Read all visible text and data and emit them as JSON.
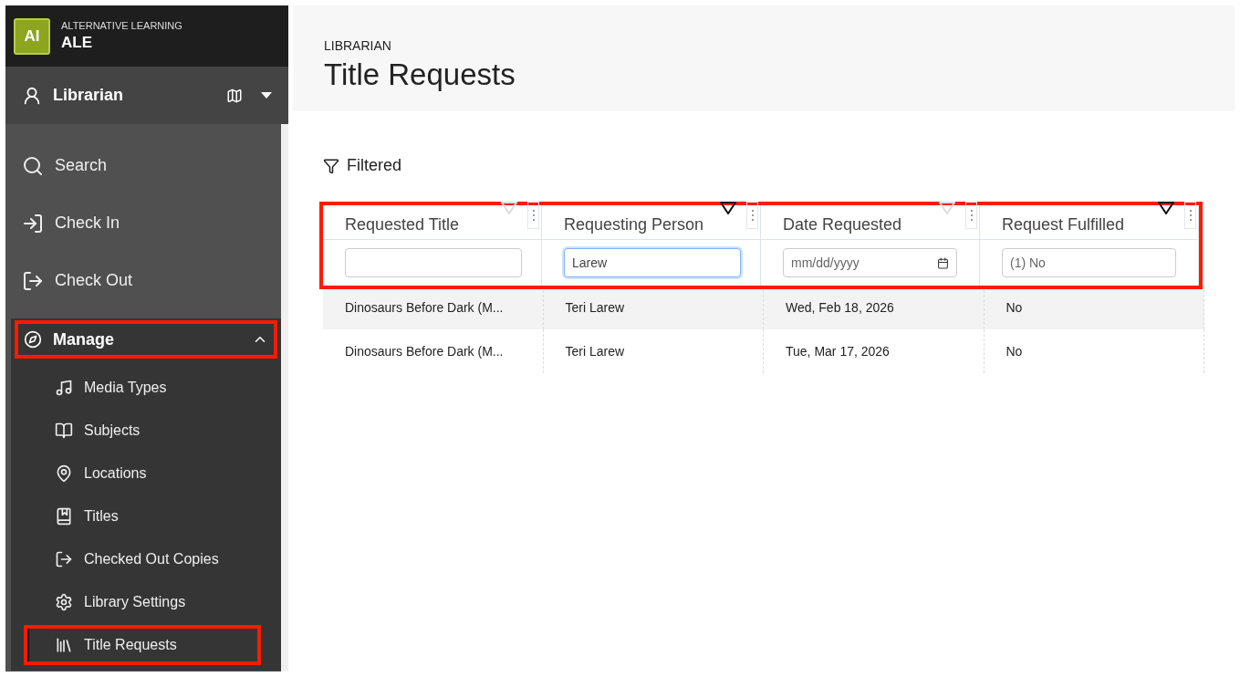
{
  "brand": {
    "logo": "AI",
    "tagline": "ALTERNATIVE LEARNING",
    "name": "ALE"
  },
  "role": {
    "label": "Librarian"
  },
  "nav": [
    {
      "label": "Search",
      "selected": false,
      "highlighted": false
    },
    {
      "label": "Check In",
      "selected": false,
      "highlighted": false
    },
    {
      "label": "Check Out",
      "selected": false,
      "highlighted": false
    },
    {
      "label": "Manage",
      "selected": false,
      "highlighted": true,
      "expanded": true,
      "children": [
        {
          "label": "Media Types",
          "selected": false,
          "highlighted": false
        },
        {
          "label": "Subjects",
          "selected": false,
          "highlighted": false
        },
        {
          "label": "Locations",
          "selected": false,
          "highlighted": false
        },
        {
          "label": "Titles",
          "selected": false,
          "highlighted": false
        },
        {
          "label": "Checked Out Copies",
          "selected": false,
          "highlighted": false
        },
        {
          "label": "Library Settings",
          "selected": false,
          "highlighted": false
        },
        {
          "label": "Title Requests",
          "selected": true,
          "highlighted": true
        }
      ]
    }
  ],
  "page": {
    "overline": "LIBRARIAN",
    "title": "Title Requests"
  },
  "filter_status": "Filtered",
  "table": {
    "header_highlighted": true,
    "columns": [
      {
        "title": "Requested Title",
        "filtered": false,
        "filter": {
          "kind": "text",
          "focused": false
        }
      },
      {
        "title": "Requesting Person",
        "filtered": true,
        "filter": {
          "kind": "text",
          "value": "Larew",
          "focused": true
        }
      },
      {
        "title": "Date Requested",
        "filtered": false,
        "filter": {
          "kind": "date",
          "placeholder": "mm/dd/yyyy"
        }
      },
      {
        "title": "Request Fulfilled",
        "filtered": true,
        "filter": {
          "kind": "select",
          "value": "(1) No"
        }
      }
    ],
    "rows": [
      {
        "selected": true,
        "cells": [
          "Dinosaurs Before Dark (M...",
          "Teri Larew",
          "Wed, Feb 18, 2026",
          "No"
        ]
      },
      {
        "selected": false,
        "cells": [
          "Dinosaurs Before Dark (M...",
          "Teri Larew",
          "Tue, Mar 17, 2026",
          "No"
        ]
      }
    ]
  }
}
